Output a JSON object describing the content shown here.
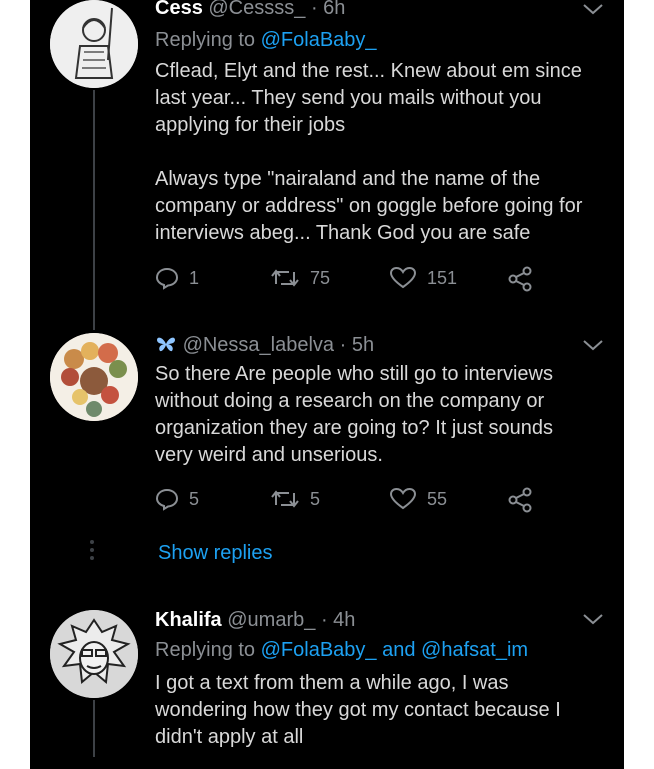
{
  "tweets": [
    {
      "name": "Cess",
      "handle": "@Cessss_",
      "sep": "·",
      "time": "6h",
      "replying_prefix": "Replying to",
      "replying_to": [
        "@FolaBaby_"
      ],
      "text_lines": [
        "Cflead, Elyt and the rest... Knew about em since",
        "last year... They send you mails without you",
        "applying for their jobs",
        "",
        "Always type \"nairaland and the name of the",
        "company or address\" on goggle before going for",
        "interviews abeg... Thank God you are safe"
      ],
      "replies": "1",
      "retweets": "75",
      "likes": "151"
    },
    {
      "name": "",
      "emoji_name": "butterfly-icon",
      "handle": "@Nessa_labelva",
      "sep": "·",
      "time": "5h",
      "text_lines": [
        "So there Are people who still go to interviews",
        "without doing a research on the company or",
        "organization they are going to?  It just sounds",
        "very weird and unserious."
      ],
      "replies": "5",
      "retweets": "5",
      "likes": "55"
    },
    {
      "name": "Khalifa",
      "handle": "@umarb_",
      "sep": "·",
      "time": "4h",
      "replying_prefix": "Replying to",
      "replying_to": [
        "@FolaBaby_",
        "@hafsat_im"
      ],
      "replying_and": "and",
      "text_lines": [
        "I got a text from them a while ago, I was",
        "wondering how they got my contact because I",
        "didn't apply at all"
      ]
    }
  ],
  "show_replies": "Show replies",
  "colors": {
    "background": "#000000",
    "text": "#d9d9d9",
    "muted": "#8b8f94",
    "accent": "#1da1f2"
  }
}
